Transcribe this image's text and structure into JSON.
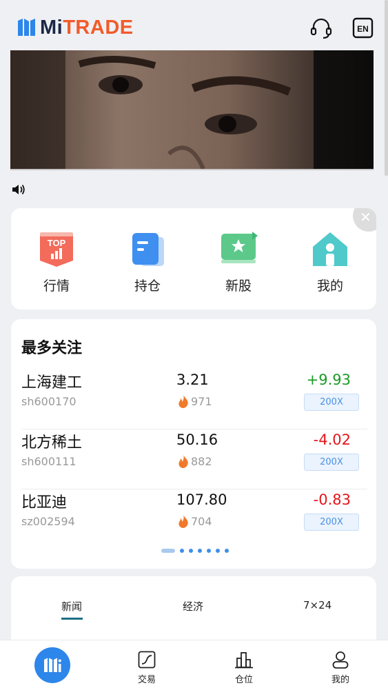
{
  "header": {
    "logo_mi": "Mi",
    "logo_trade": "TRADE",
    "support_icon": "headset-icon",
    "lang_label": "EN"
  },
  "banner": {
    "icon": "video-banner"
  },
  "sound_icon": "speaker-icon",
  "quick_menu": {
    "items": [
      {
        "label": "行情",
        "icon": "top-chart-icon",
        "badge": "TOP"
      },
      {
        "label": "持仓",
        "icon": "document-icon"
      },
      {
        "label": "新股",
        "icon": "star-board-icon"
      },
      {
        "label": "我的",
        "icon": "home-icon"
      }
    ],
    "close_icon": "close-icon"
  },
  "watchlist": {
    "title": "最多关注",
    "rows": [
      {
        "name": "上海建工",
        "code": "sh600170",
        "price": "3.21",
        "heat": "971",
        "change": "+9.93",
        "direction": "up",
        "leverage": "200X"
      },
      {
        "name": "北方稀土",
        "code": "sh600111",
        "price": "50.16",
        "heat": "882",
        "change": "-4.02",
        "direction": "down",
        "leverage": "200X"
      },
      {
        "name": "比亚迪",
        "code": "sz002594",
        "price": "107.80",
        "heat": "704",
        "change": "-0.83",
        "direction": "down",
        "leverage": "200X"
      }
    ],
    "pager": {
      "pages": 7,
      "active": 1
    }
  },
  "news": {
    "tabs": [
      {
        "label": "新闻",
        "active": true
      },
      {
        "label": "经济",
        "active": false
      },
      {
        "label": "7×24",
        "active": false
      }
    ]
  },
  "tabbar": {
    "items": [
      {
        "label": "",
        "icon": "mitrade-home-icon"
      },
      {
        "label": "交易",
        "icon": "trade-chart-icon"
      },
      {
        "label": "仓位",
        "icon": "bar-chart-icon"
      },
      {
        "label": "我的",
        "icon": "user-icon"
      }
    ]
  },
  "colors": {
    "up": "#1a9a26",
    "down": "#e4151b",
    "brand_blue": "#2d86ea",
    "brand_orange": "#f15b2a",
    "tab_indicator": "#1b6f87"
  }
}
